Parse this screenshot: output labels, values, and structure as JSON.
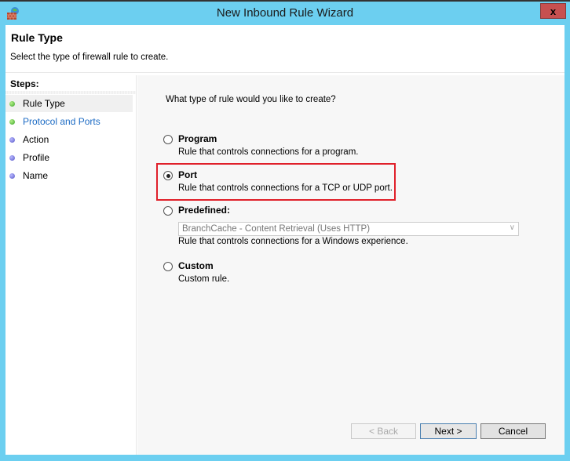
{
  "window": {
    "title": "New Inbound Rule Wizard",
    "close_label": "x",
    "icon": "firewall-icon"
  },
  "header": {
    "title": "Rule Type",
    "subtitle": "Select the type of firewall rule to create."
  },
  "sidebar": {
    "steps_label": "Steps:",
    "steps": [
      {
        "label": "Rule Type",
        "status": "complete",
        "current": true
      },
      {
        "label": "Protocol and Ports",
        "status": "complete",
        "current": false
      },
      {
        "label": "Action",
        "status": "pending",
        "current": false
      },
      {
        "label": "Profile",
        "status": "pending",
        "current": false
      },
      {
        "label": "Name",
        "status": "pending",
        "current": false
      }
    ]
  },
  "main": {
    "question": "What type of rule would you like to create?",
    "options": [
      {
        "label": "Program",
        "description": "Rule that controls connections for a program.",
        "selected": false
      },
      {
        "label": "Port",
        "description": "Rule that controls connections for a TCP or UDP port.",
        "selected": true
      },
      {
        "label": "Predefined:",
        "description": "Rule that controls connections for a Windows experience.",
        "selected": false,
        "dropdown_value": "BranchCache - Content Retrieval (Uses HTTP)"
      },
      {
        "label": "Custom",
        "description": "Custom rule.",
        "selected": false
      }
    ],
    "highlight_color": "#e0202a"
  },
  "buttons": {
    "back": "< Back",
    "next": "Next >",
    "cancel": "Cancel"
  }
}
